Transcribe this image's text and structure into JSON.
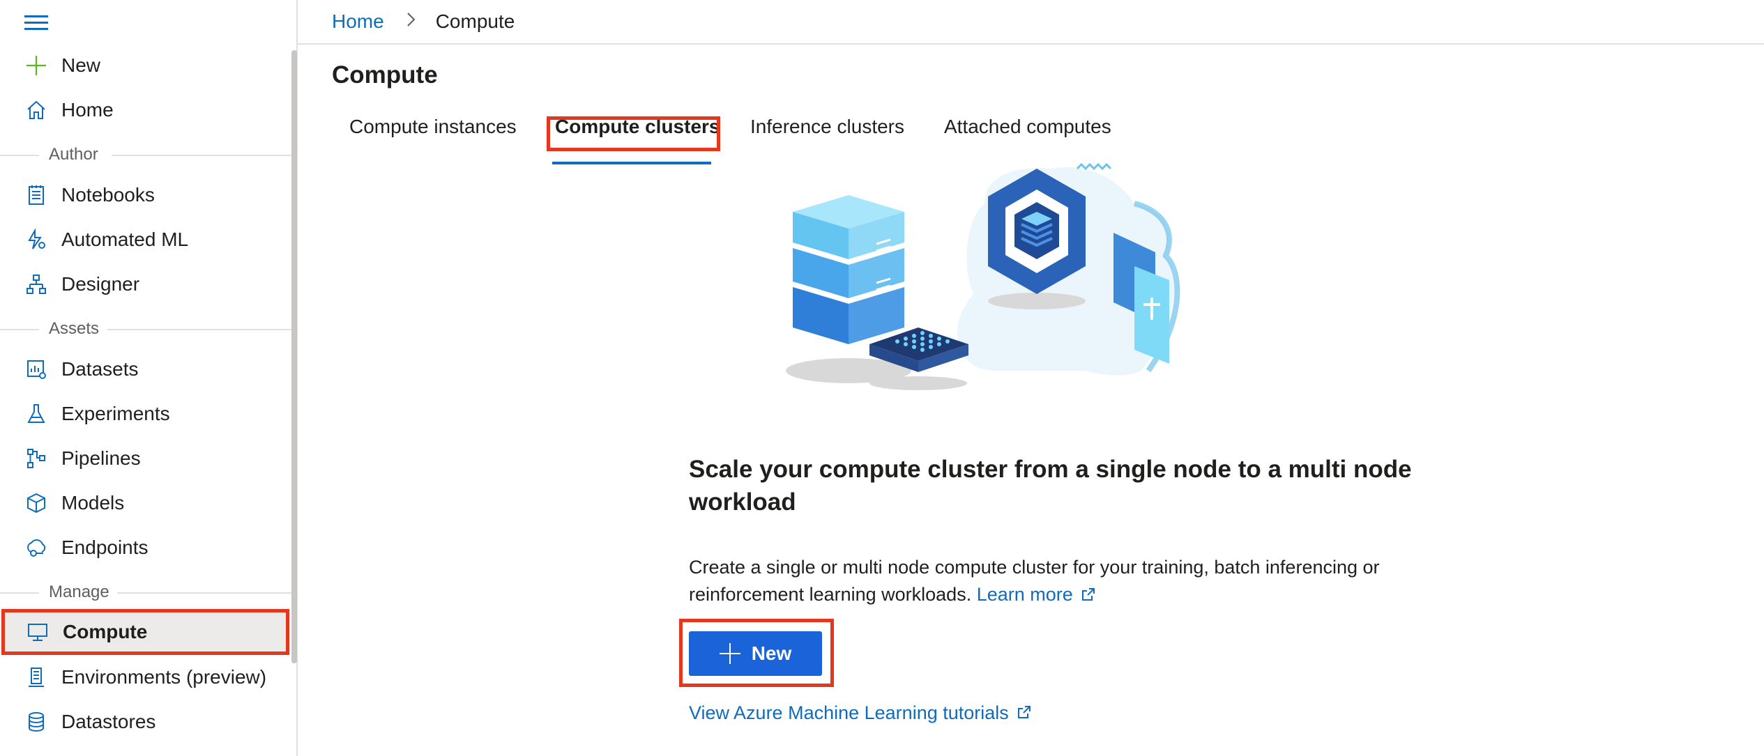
{
  "sidebar": {
    "top_items": [
      {
        "label": "New",
        "icon": "plus-icon"
      },
      {
        "label": "Home",
        "icon": "home-icon"
      }
    ],
    "groups": {
      "author": "Author",
      "assets": "Assets",
      "manage": "Manage"
    },
    "author_items": [
      {
        "label": "Notebooks",
        "icon": "notebook-icon"
      },
      {
        "label": "Automated ML",
        "icon": "automated-ml-icon"
      },
      {
        "label": "Designer",
        "icon": "designer-icon"
      }
    ],
    "assets_items": [
      {
        "label": "Datasets",
        "icon": "datasets-icon"
      },
      {
        "label": "Experiments",
        "icon": "flask-icon"
      },
      {
        "label": "Pipelines",
        "icon": "pipelines-icon"
      },
      {
        "label": "Models",
        "icon": "cube-icon"
      },
      {
        "label": "Endpoints",
        "icon": "endpoints-icon"
      }
    ],
    "manage_items": [
      {
        "label": "Compute",
        "icon": "monitor-icon",
        "active": true
      },
      {
        "label": "Environments (preview)",
        "icon": "environments-icon"
      },
      {
        "label": "Datastores",
        "icon": "database-icon"
      }
    ]
  },
  "breadcrumb": {
    "home": "Home",
    "current": "Compute"
  },
  "page": {
    "title": "Compute",
    "tabs": [
      {
        "label": "Compute instances"
      },
      {
        "label": "Compute clusters",
        "active": true
      },
      {
        "label": "Inference clusters"
      },
      {
        "label": "Attached computes"
      }
    ],
    "heading": "Scale your compute cluster from a single node to a multi node workload",
    "description": "Create a single or multi node compute cluster for your training, batch inferencing or reinforcement learning workloads.",
    "learn_more": "Learn more",
    "new_button": "New",
    "tutorials_link": "View Azure Machine Learning tutorials"
  },
  "colors": {
    "accent": "#0f6cbd",
    "button": "#1a63d8",
    "highlight": "#e5371d"
  }
}
